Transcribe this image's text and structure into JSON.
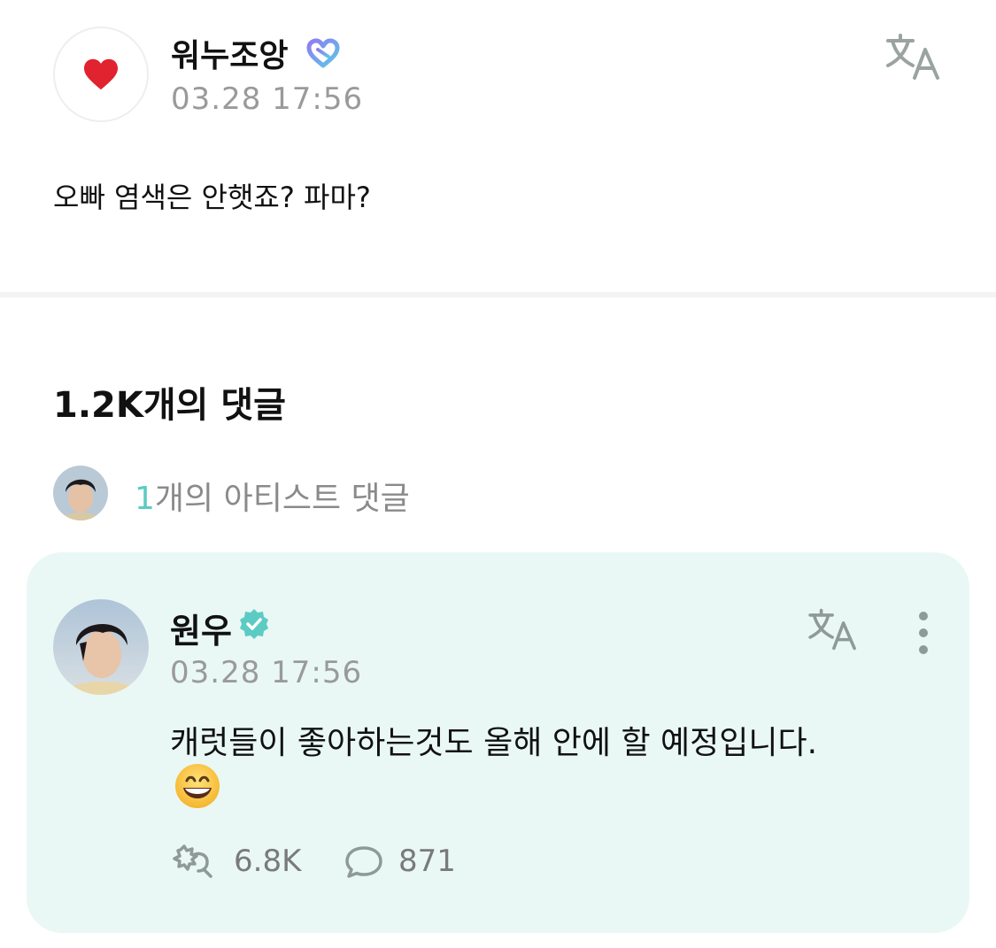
{
  "post": {
    "author": "워누조앙",
    "time": "03.28 17:56",
    "body": "오빠 염색은 안햇죠? 파마?",
    "avatar_icon": "heart-icon",
    "badge_icon": "membership-badge-icon",
    "translate_icon": "translate-icon"
  },
  "comments": {
    "title": "1.2K개의 댓글",
    "artist_summary": {
      "count": "1",
      "label": "개의 아티스트 댓글"
    }
  },
  "artist_comment": {
    "name": "원우",
    "time": "03.28 17:56",
    "text": "캐럿들이 좋아하는것도 올해 안에 할 예정입니다.",
    "emoji": "grinning-face-emoji",
    "likes": "6.8K",
    "replies": "871",
    "verified_icon": "verified-badge-icon"
  },
  "colors": {
    "accent": "#5ccbc4",
    "card_bg": "#e9f8f5",
    "muted_text": "#9a9a9a",
    "icon_gray": "#8f9a98"
  }
}
